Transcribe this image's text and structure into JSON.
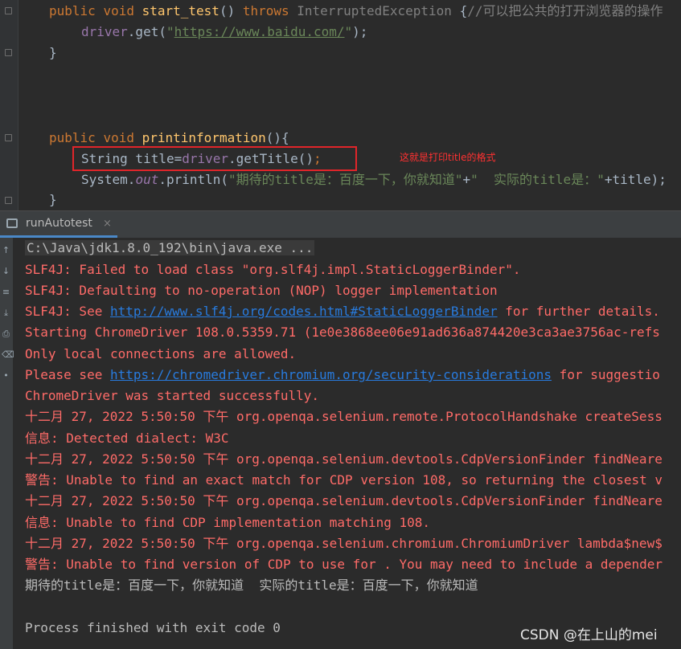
{
  "editor": {
    "line1": {
      "kw_public": "public",
      "kw_void": "void",
      "method": "start_test",
      "paren": "()",
      "kw_throws": "throws",
      "exception": "InterruptedException",
      "brace": "{",
      "comment": "//可以把公共的打开浏览器的操作"
    },
    "line2": {
      "field": "driver",
      "call": ".get(",
      "quote_open": "\"",
      "url": "https://www.baidu.com/",
      "quote_close": "\"",
      "end": ");"
    },
    "line3": "}",
    "line4": {
      "kw_public": "public",
      "kw_void": "void",
      "method": "printinformation",
      "rest": "(){"
    },
    "line5": {
      "decl": "String title=",
      "field": "driver",
      "call": ".getTitle()",
      "semi": ";"
    },
    "line6": {
      "sys": "System.",
      "out": "out",
      "println": ".println(",
      "str1": "\"期待的title是：百度一下，你就知道\"",
      "plus": "+",
      "str2": "\"  实际的title是：\"",
      "rest": "+title);"
    },
    "line7": "}",
    "annotation": "这就是打印title的格式"
  },
  "run_panel": {
    "tab_label": "runAutotest",
    "tab_close": "×"
  },
  "console": {
    "cmd": "C:\\Java\\jdk1.8.0_192\\bin\\java.exe ...",
    "l1": "SLF4J: Failed to load class \"org.slf4j.impl.StaticLoggerBinder\".",
    "l2": "SLF4J: Defaulting to no-operation (NOP) logger implementation",
    "l3_pre": "SLF4J: See ",
    "l3_link": "http://www.slf4j.org/codes.html#StaticLoggerBinder",
    "l3_post": " for further details.",
    "l4": "Starting ChromeDriver 108.0.5359.71 (1e0e3868ee06e91ad636a874420e3ca3ae3756ac-refs",
    "l5": "Only local connections are allowed.",
    "l6_pre": "Please see ",
    "l6_link": "https://chromedriver.chromium.org/security-considerations",
    "l6_post": " for suggestio",
    "l7": "ChromeDriver was started successfully.",
    "l8": "十二月 27, 2022 5:50:50 下午 org.openqa.selenium.remote.ProtocolHandshake createSess",
    "l9": "信息: Detected dialect: W3C",
    "l10": "十二月 27, 2022 5:50:50 下午 org.openqa.selenium.devtools.CdpVersionFinder findNeare",
    "l11": "警告: Unable to find an exact match for CDP version 108, so returning the closest v",
    "l12": "十二月 27, 2022 5:50:50 下午 org.openqa.selenium.devtools.CdpVersionFinder findNeare",
    "l13": "信息: Unable to find CDP implementation matching 108.",
    "l14": "十二月 27, 2022 5:50:50 下午 org.openqa.selenium.chromium.ChromiumDriver lambda$new$",
    "l15": "警告: Unable to find version of CDP to use for . You may need to include a depender",
    "l16": "期待的title是：百度一下，你就知道  实际的title是：百度一下，你就知道",
    "l17": "",
    "l18": "Process finished with exit code 0"
  },
  "watermark": "CSDN @在上山的mei",
  "colors": {
    "background": "#2b2b2b",
    "keyword": "#cc7832",
    "method": "#ffc66d",
    "field": "#9876aa",
    "string": "#6a8759",
    "error_text": "#ff6b68",
    "link": "#287bde",
    "highlight_box": "#e0252a"
  }
}
